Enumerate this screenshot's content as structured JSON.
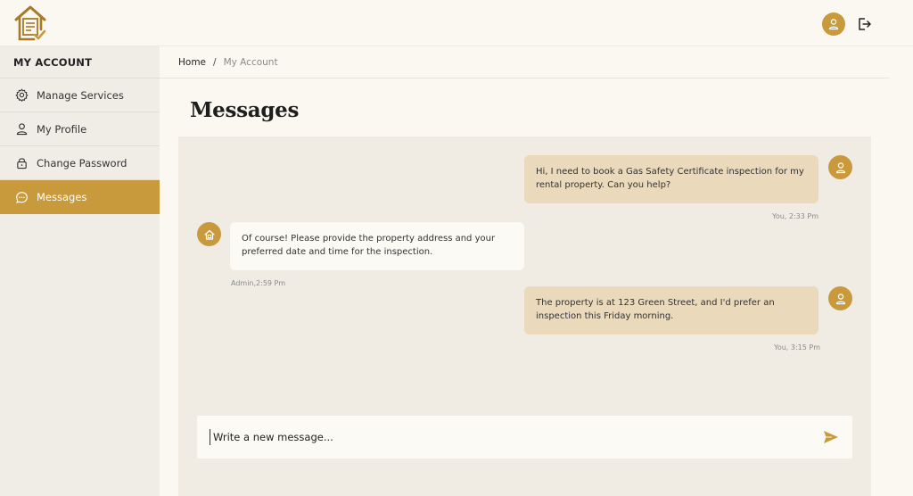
{
  "sidebar": {
    "title": "MY ACCOUNT",
    "items": [
      {
        "label": "Manage Services",
        "icon": "gear-icon"
      },
      {
        "label": "My Profile",
        "icon": "user-icon"
      },
      {
        "label": "Change Password",
        "icon": "lock-icon"
      },
      {
        "label": "Messages",
        "icon": "chat-icon",
        "active": true
      }
    ]
  },
  "breadcrumb": {
    "home": "Home",
    "separator": "/",
    "current": "My Account"
  },
  "page": {
    "title": "Messages"
  },
  "messages": [
    {
      "sender": "user",
      "text": "Hi, I need to book a Gas Safety Certificate inspection for my rental property. Can you help?",
      "meta": "You, 2:33 Pm"
    },
    {
      "sender": "admin",
      "text": "Of course! Please provide the property address and your preferred date and time for the inspection.",
      "meta": "Admin,2:59 Pm"
    },
    {
      "sender": "user",
      "text": "The property is at 123 Green Street, and I'd prefer an inspection this Friday morning.",
      "meta": "You, 3:15 Pm"
    }
  ],
  "composer": {
    "placeholder": "Write a new message..."
  },
  "colors": {
    "accent": "#c99a3c",
    "user_bubble": "#ead9bb",
    "admin_bubble": "#fcfaf5",
    "panel": "#f0ece3"
  }
}
